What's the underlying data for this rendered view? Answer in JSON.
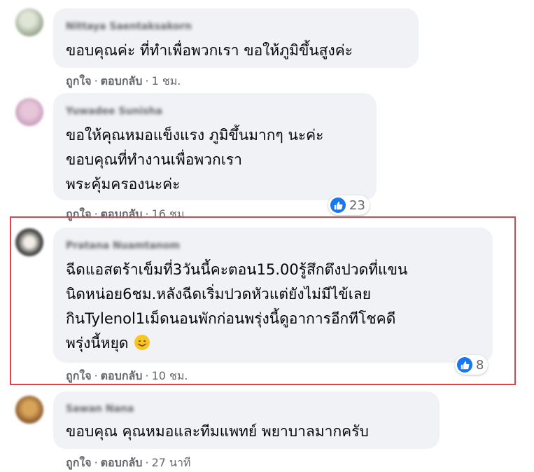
{
  "labels": {
    "like": "ถูกใจ",
    "reply": "ตอบกลับ",
    "dot": "·"
  },
  "colors": {
    "highlight": "#e2414a",
    "like_blue": "#1877f2",
    "bubble": "#f0f2f5"
  },
  "comments": [
    {
      "author": "Nittaya Saentaksakorn",
      "lines": [
        "ขอบคุณค่ะ ที่ทำเพื่อพวกเรา ขอให้ภูมิขึ้นสูงค่ะ"
      ],
      "time": "1 ชม."
    },
    {
      "author": "Yuwadee Sunisha",
      "lines": [
        "ขอให้คุณหมอแข็งแรง ภูมิขึ้นมากๆ นะค่ะ",
        "ขอบคุณที่ทำงานเพื่อพวกเรา",
        "พระคุ้มครองนะค่ะ"
      ],
      "time": "16 ชม.",
      "reactions": "23"
    },
    {
      "author": "Pratana Nuamtanom",
      "lines": [
        "ฉีดแอสตร้าเข็มที่3วันนี้คะตอน15.00รู้สึกตึงปวดที่แขน",
        "นิดหน่อย6ชม.หลังฉีดเริ่มปวดหัวแต่ยังไม่มีไข้เลย",
        "กินTylenol1เม็ดนอนพักก่อนพรุ่งนี้ดูอาการอีกทีโชคดี",
        "พรุ่งนี้หยุด"
      ],
      "emoji": "smiling-face-emoji",
      "time": "10 ชม.",
      "reactions": "8",
      "highlighted": true
    },
    {
      "author": "Sawan Nana",
      "lines": [
        "ขอบคุณ คุณหมอและทีมแพทย์ พยาบาลมากครับ"
      ],
      "time": "27 นาที"
    }
  ]
}
